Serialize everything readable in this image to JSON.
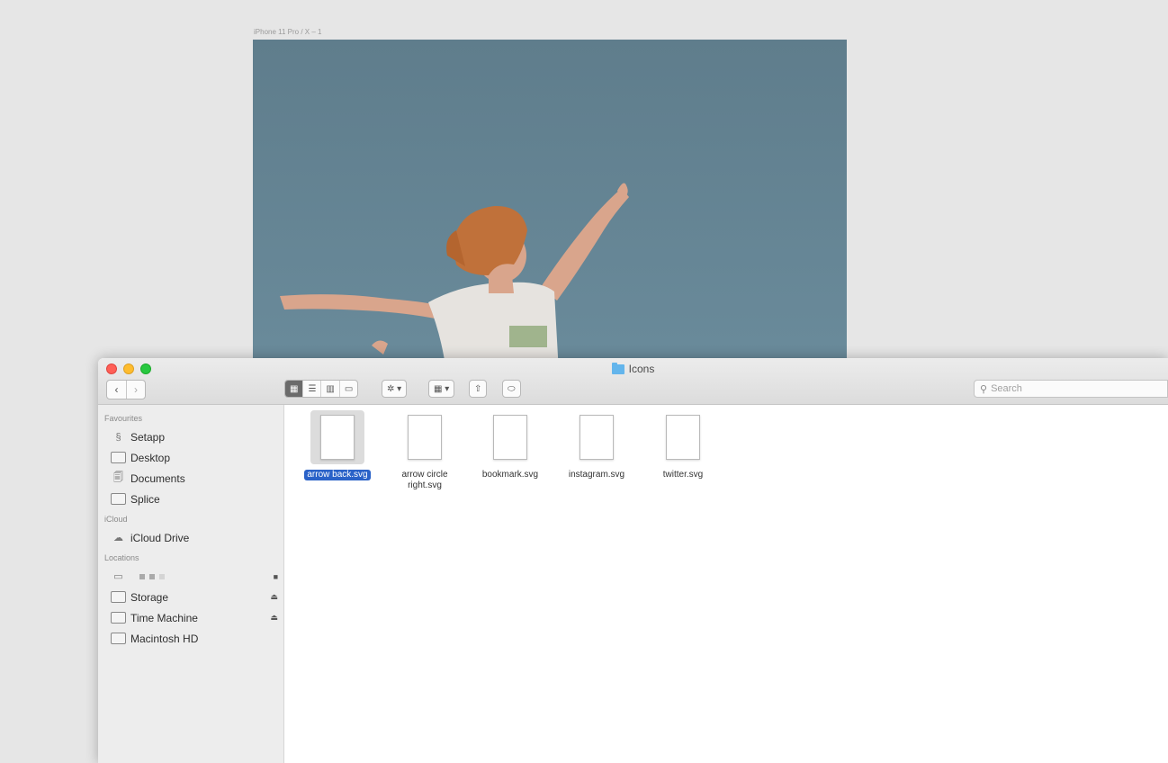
{
  "artboard": {
    "label": "iPhone 11 Pro / X – 1"
  },
  "window": {
    "title": "Icons",
    "search_placeholder": "Search"
  },
  "toolbar": {
    "view_icons": "▦",
    "view_list": "☰",
    "view_columns": "▥",
    "view_gallery": "▭",
    "action": "✲ ▾",
    "group": "▦ ▾",
    "share": "⇧",
    "tag": "⬭"
  },
  "sidebar": {
    "favourites_heading": "Favourites",
    "favourites": [
      {
        "label": "Setapp",
        "icon": "setapp-icon"
      },
      {
        "label": "Desktop",
        "icon": "desktop-folder-icon"
      },
      {
        "label": "Documents",
        "icon": "documents-folder-icon"
      },
      {
        "label": "Splice",
        "icon": "folder-icon"
      }
    ],
    "icloud_heading": "iCloud",
    "icloud": [
      {
        "label": "iCloud Drive",
        "icon": "cloud-icon"
      }
    ],
    "locations_heading": "Locations",
    "locations": [
      {
        "label": "Storage",
        "icon": "drive-icon",
        "eject": "⏏"
      },
      {
        "label": "Time Machine",
        "icon": "time-machine-icon",
        "eject": "⏏"
      },
      {
        "label": "Macintosh HD",
        "icon": "hard-disk-icon"
      }
    ]
  },
  "files": [
    {
      "name": "arrow back.svg",
      "selected": true
    },
    {
      "name": "arrow circle right.svg",
      "selected": false
    },
    {
      "name": "bookmark.svg",
      "selected": false
    },
    {
      "name": "instagram.svg",
      "selected": false
    },
    {
      "name": "twitter.svg",
      "selected": false
    }
  ]
}
